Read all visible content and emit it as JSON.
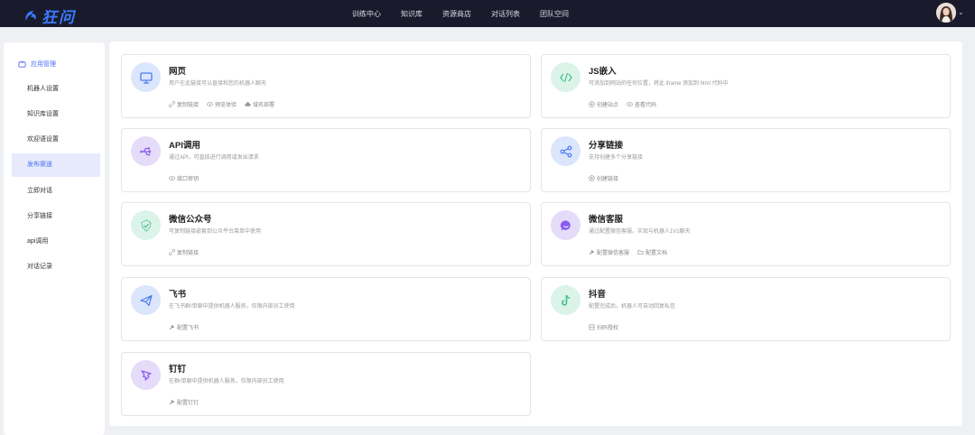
{
  "header": {
    "logo_text": "狂问",
    "nav": [
      "训练中心",
      "知识库",
      "资源商店",
      "对话列表",
      "团队空间"
    ]
  },
  "sidebar": {
    "group_label": "应用管理",
    "items": [
      {
        "label": "机器人设置"
      },
      {
        "label": "知识库设置"
      },
      {
        "label": "欢迎语设置"
      },
      {
        "label": "发布渠道"
      },
      {
        "label": "立即对话"
      },
      {
        "label": "分享链接"
      },
      {
        "label": "api调用"
      },
      {
        "label": "对话记录"
      }
    ]
  },
  "cards": [
    {
      "title": "网页",
      "desc": "用户在此链接可以直接和您的机器人聊天",
      "icon": "monitor-icon",
      "color": "#4a7cf0",
      "actions": [
        {
          "label": "复制链接",
          "icon": "link-icon"
        },
        {
          "label": "预览体验",
          "icon": "eye-icon"
        },
        {
          "label": "域名部署",
          "icon": "cloud-icon"
        }
      ]
    },
    {
      "title": "JS嵌入",
      "desc": "可添加到网站的任何位置，将此 iframe 添加到 html 代码中",
      "icon": "code-icon",
      "color": "#3fbf8c",
      "actions": [
        {
          "label": "创建站点",
          "icon": "plus-circle-icon"
        },
        {
          "label": "查看代码",
          "icon": "eye-icon"
        }
      ]
    },
    {
      "title": "API调用",
      "desc": "通过API，可直接进行调用或发出请求",
      "icon": "usb-icon",
      "color": "#8a5cf0",
      "actions": [
        {
          "label": "接口密钥",
          "icon": "eye-icon"
        }
      ]
    },
    {
      "title": "分享链接",
      "desc": "支持创建多个分享链接",
      "icon": "share-icon",
      "color": "#4a7cf0",
      "actions": [
        {
          "label": "创建链接",
          "icon": "plus-circle-icon"
        }
      ]
    },
    {
      "title": "微信公众号",
      "desc": "可复制链接嵌套到公众平台菜单中使用",
      "icon": "shield-check-icon",
      "color": "#3fbf8c",
      "actions": [
        {
          "label": "复制链接",
          "icon": "link-icon"
        }
      ]
    },
    {
      "title": "微信客服",
      "desc": "通过配置微信客服，实现与机器人1V1聊天",
      "icon": "chat-icon",
      "color": "#8a5cf0",
      "actions": [
        {
          "label": "配置微信客服",
          "icon": "wrench-icon"
        },
        {
          "label": "配置文档",
          "icon": "folder-icon"
        }
      ]
    },
    {
      "title": "飞书",
      "desc": "在飞书群/单聊中提供机器人服务，仅限内部员工使用",
      "icon": "paper-plane-icon",
      "color": "#4a7cf0",
      "actions": [
        {
          "label": "配置飞书",
          "icon": "wrench-icon"
        }
      ]
    },
    {
      "title": "抖音",
      "desc": "配置完成后，机器人可自动回复私信",
      "icon": "tiktok-icon",
      "color": "#3fbf8c",
      "actions": [
        {
          "label": "扫码授权",
          "icon": "qrcode-icon"
        }
      ]
    },
    {
      "title": "钉钉",
      "desc": "在群/单聊中提供机器人服务，仅限内部员工使用",
      "icon": "dingtalk-icon",
      "color": "#8a5cf0",
      "actions": [
        {
          "label": "配置钉钉",
          "icon": "wrench-icon"
        }
      ]
    }
  ]
}
